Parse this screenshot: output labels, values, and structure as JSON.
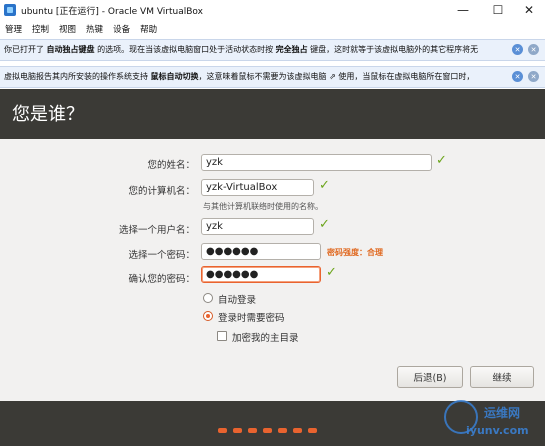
{
  "window": {
    "title": "ubuntu [正在运行] - Oracle VM VirtualBox",
    "minimize": "—",
    "maximize": "☐",
    "close": "✕"
  },
  "menu": [
    "管理",
    "控制",
    "视图",
    "热键",
    "设备",
    "帮助"
  ],
  "notifications": [
    {
      "pre": "你已打开了 ",
      "bold1": "自动独占键盘",
      "mid": " 的选项。现在当该虚拟电脑窗口处于活动状态时按 ",
      "bold2": "完全独占",
      "post": " 键盘，这时就等于该虚拟电脑外的其它程序将无"
    },
    {
      "pre": "虚拟电脑报告其内所安装的操作系统支持 ",
      "bold1": "鼠标自动切换",
      "post": "，这意味着鼠标不需要为该虚拟电脑 ",
      "icon_text": "⇗",
      "tail": " 使用，当鼠标在虚拟电脑所在窗口时，"
    }
  ],
  "installer": {
    "heading": "您是谁？",
    "fields": {
      "name_label": "您的姓名：",
      "name_value": "yzk",
      "computer_label": "您的计算机名：",
      "computer_value": "yzk-VirtualBox",
      "computer_hint": "与其他计算机联络时使用的名称。",
      "username_label": "选择一个用户名：",
      "username_value": "yzk",
      "password_label": "选择一个密码：",
      "password_value": "●●●●●●",
      "password_strength": "密码强度：合理",
      "confirm_label": "确认您的密码：",
      "confirm_value": "●●●●●●"
    },
    "options": {
      "auto_login": "自动登录",
      "require_password": "登录时需要密码",
      "encrypt_home": "加密我的主目录"
    },
    "buttons": {
      "back": "后退(B)",
      "continue": "继续"
    },
    "check_mark": "✓"
  },
  "watermark": {
    "cn": "运维网",
    "url": "iyunv.com"
  },
  "colors": {
    "accent": "#e9632f",
    "check": "#6ca51c",
    "dark_panel": "#3b3a36"
  }
}
